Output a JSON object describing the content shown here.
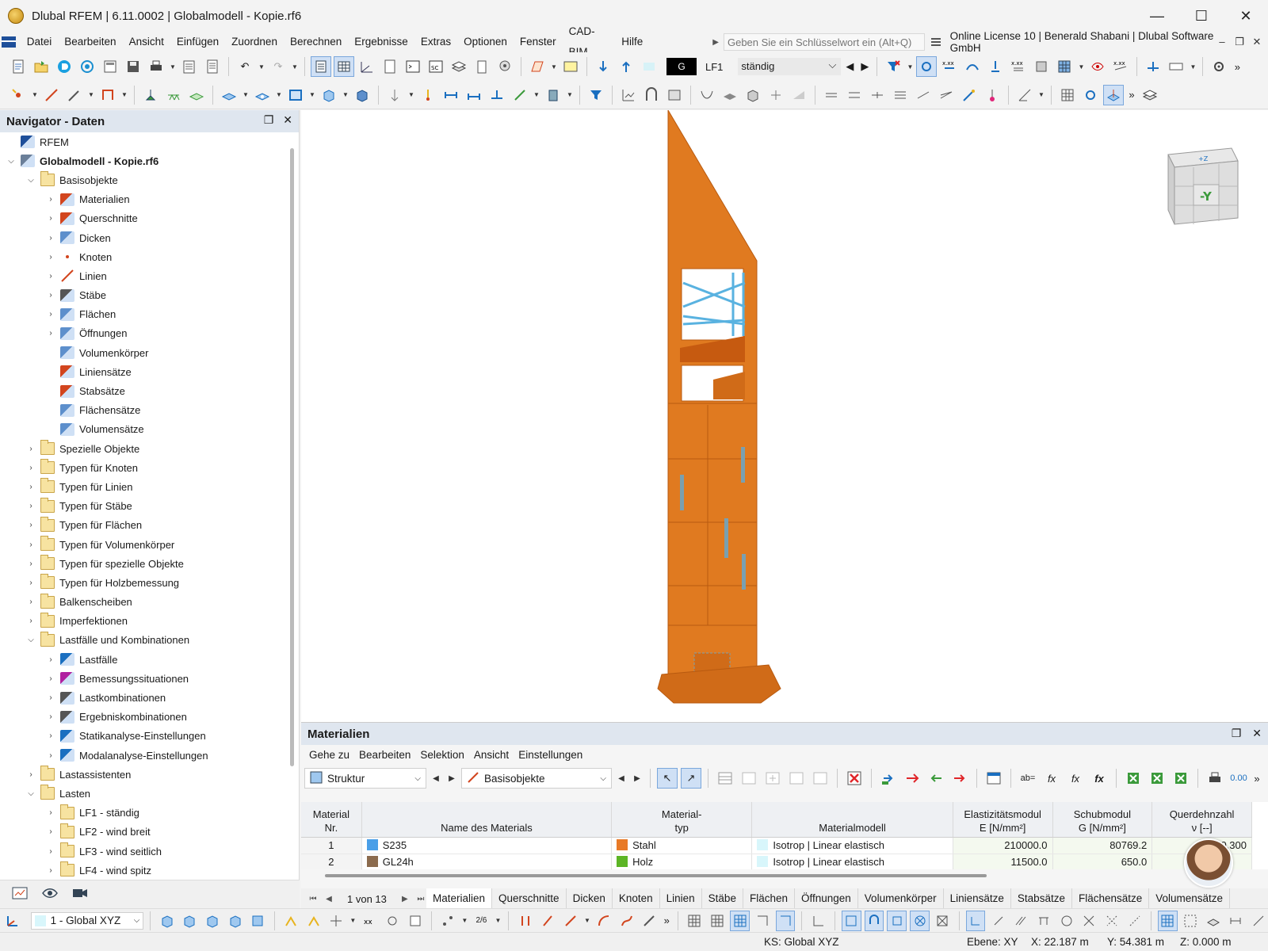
{
  "window": {
    "title": "Dlubal RFEM | 6.11.0002 | Globalmodell - Kopie.rf6",
    "minimize": "—",
    "maximize": "☐",
    "close": "✕"
  },
  "menubar": {
    "items": [
      "Datei",
      "Bearbeiten",
      "Ansicht",
      "Einfügen",
      "Zuordnen",
      "Berechnen",
      "Ergebnisse",
      "Extras",
      "Optionen",
      "Fenster",
      "CAD-BIM",
      "Hilfe"
    ],
    "search_placeholder": "Geben Sie ein Schlüsselwort ein (Alt+Q)",
    "license": "Online License 10 | Benerald Shabani | Dlubal Software GmbH"
  },
  "toolbar": {
    "loadcase_color_label": "G",
    "loadcase": "LF1",
    "loadcase_name": "ständig"
  },
  "navigator": {
    "title": "Navigator - Daten",
    "rows": [
      {
        "level": 0,
        "arrow": "",
        "icon": "rfem-icon",
        "label": "RFEM",
        "bold": false
      },
      {
        "level": 0,
        "arrow": "⌵",
        "icon": "model-icon",
        "label": "Globalmodell - Kopie.rf6",
        "bold": true
      },
      {
        "level": 1,
        "arrow": "⌵",
        "icon": "folder-icon",
        "label": "Basisobjekte",
        "bold": false
      },
      {
        "level": 2,
        "arrow": "›",
        "icon": "materials-icon",
        "label": "Materialien",
        "bold": false
      },
      {
        "level": 2,
        "arrow": "›",
        "icon": "cross-section-icon",
        "label": "Querschnitte",
        "bold": false
      },
      {
        "level": 2,
        "arrow": "›",
        "icon": "thickness-icon",
        "label": "Dicken",
        "bold": false
      },
      {
        "level": 2,
        "arrow": "›",
        "icon": "node-icon",
        "label": "Knoten",
        "bold": false
      },
      {
        "level": 2,
        "arrow": "›",
        "icon": "line-icon",
        "label": "Linien",
        "bold": false
      },
      {
        "level": 2,
        "arrow": "›",
        "icon": "member-icon",
        "label": "Stäbe",
        "bold": false
      },
      {
        "level": 2,
        "arrow": "›",
        "icon": "surface-icon",
        "label": "Flächen",
        "bold": false
      },
      {
        "level": 2,
        "arrow": "›",
        "icon": "opening-icon",
        "label": "Öffnungen",
        "bold": false
      },
      {
        "level": 2,
        "arrow": "",
        "icon": "solid-icon",
        "label": "Volumenkörper",
        "bold": false
      },
      {
        "level": 2,
        "arrow": "",
        "icon": "line-set-icon",
        "label": "Liniensätze",
        "bold": false
      },
      {
        "level": 2,
        "arrow": "",
        "icon": "member-set-icon",
        "label": "Stabsätze",
        "bold": false
      },
      {
        "level": 2,
        "arrow": "",
        "icon": "surface-set-icon",
        "label": "Flächensätze",
        "bold": false
      },
      {
        "level": 2,
        "arrow": "",
        "icon": "solid-set-icon",
        "label": "Volumensätze",
        "bold": false
      },
      {
        "level": 1,
        "arrow": "›",
        "icon": "folder-icon",
        "label": "Spezielle Objekte",
        "bold": false
      },
      {
        "level": 1,
        "arrow": "›",
        "icon": "folder-icon",
        "label": "Typen für Knoten",
        "bold": false
      },
      {
        "level": 1,
        "arrow": "›",
        "icon": "folder-icon",
        "label": "Typen für Linien",
        "bold": false
      },
      {
        "level": 1,
        "arrow": "›",
        "icon": "folder-icon",
        "label": "Typen für Stäbe",
        "bold": false
      },
      {
        "level": 1,
        "arrow": "›",
        "icon": "folder-icon",
        "label": "Typen für Flächen",
        "bold": false
      },
      {
        "level": 1,
        "arrow": "›",
        "icon": "folder-icon",
        "label": "Typen für Volumenkörper",
        "bold": false
      },
      {
        "level": 1,
        "arrow": "›",
        "icon": "folder-icon",
        "label": "Typen für spezielle Objekte",
        "bold": false
      },
      {
        "level": 1,
        "arrow": "›",
        "icon": "folder-icon",
        "label": "Typen für Holzbemessung",
        "bold": false
      },
      {
        "level": 1,
        "arrow": "›",
        "icon": "folder-icon",
        "label": "Balkenscheiben",
        "bold": false
      },
      {
        "level": 1,
        "arrow": "›",
        "icon": "folder-icon",
        "label": "Imperfektionen",
        "bold": false
      },
      {
        "level": 1,
        "arrow": "⌵",
        "icon": "folder-icon",
        "label": "Lastfälle und Kombinationen",
        "bold": false
      },
      {
        "level": 2,
        "arrow": "›",
        "icon": "load-case-icon",
        "label": "Lastfälle",
        "bold": false
      },
      {
        "level": 2,
        "arrow": "›",
        "icon": "design-situation-icon",
        "label": "Bemessungssituationen",
        "bold": false
      },
      {
        "level": 2,
        "arrow": "›",
        "icon": "load-combination-icon",
        "label": "Lastkombinationen",
        "bold": false
      },
      {
        "level": 2,
        "arrow": "›",
        "icon": "result-combination-icon",
        "label": "Ergebniskombinationen",
        "bold": false
      },
      {
        "level": 2,
        "arrow": "›",
        "icon": "static-settings-icon",
        "label": "Statikanalyse-Einstellungen",
        "bold": false
      },
      {
        "level": 2,
        "arrow": "›",
        "icon": "modal-settings-icon",
        "label": "Modalanalyse-Einstellungen",
        "bold": false
      },
      {
        "level": 1,
        "arrow": "›",
        "icon": "folder-icon",
        "label": "Lastassistenten",
        "bold": false
      },
      {
        "level": 1,
        "arrow": "⌵",
        "icon": "folder-icon",
        "label": "Lasten",
        "bold": false
      },
      {
        "level": 2,
        "arrow": "›",
        "icon": "folder-icon",
        "label": "LF1 - ständig",
        "bold": false
      },
      {
        "level": 2,
        "arrow": "›",
        "icon": "folder-icon",
        "label": "LF2 - wind breit",
        "bold": false
      },
      {
        "level": 2,
        "arrow": "›",
        "icon": "folder-icon",
        "label": "LF3 - wind seitlich",
        "bold": false
      },
      {
        "level": 2,
        "arrow": "›",
        "icon": "folder-icon",
        "label": "LF4 - wind spitz",
        "bold": false
      }
    ]
  },
  "viewport": {
    "view_cube_label": "-Y",
    "view_cube_top": "+Z"
  },
  "materials_panel": {
    "title": "Materialien",
    "menu": [
      "Gehe zu",
      "Bearbeiten",
      "Selektion",
      "Ansicht",
      "Einstellungen"
    ],
    "structure_dropdown": "Struktur",
    "objects_dropdown": "Basisobjekte",
    "columns": {
      "nr": [
        "Material",
        "Nr."
      ],
      "name": "Name des Materials",
      "type": [
        "Material-",
        "typ"
      ],
      "model": "Materialmodell",
      "e": [
        "Elastizitätsmodul",
        "E [N/mm²]"
      ],
      "g": [
        "Schubmodul",
        "G [N/mm²]"
      ],
      "nu": [
        "Querdehnzahl",
        "ν [--]"
      ]
    },
    "rows": [
      {
        "nr": "1",
        "name": "S235",
        "name_color": "#4a9fe8",
        "type": "Stahl",
        "type_color": "#e87a27",
        "model": "Isotrop | Linear elastisch",
        "e": "210000.0",
        "g": "80769.2",
        "nu": "0.300"
      },
      {
        "nr": "2",
        "name": "GL24h",
        "name_color": "#8b6b4e",
        "type": "Holz",
        "type_color": "#5db526",
        "model": "Isotrop | Linear elastisch",
        "e": "11500.0",
        "g": "650.0",
        "nu": ""
      }
    ],
    "pager": "1 von 13",
    "tabs": [
      "Materialien",
      "Querschnitte",
      "Dicken",
      "Knoten",
      "Linien",
      "Stäbe",
      "Flächen",
      "Öffnungen",
      "Volumenkörper",
      "Liniensätze",
      "Stabsätze",
      "Flächensätze",
      "Volumensätze"
    ],
    "active_tab": "Materialien"
  },
  "bottom_toolbar": {
    "coordinate_system": "1 - Global XYZ"
  },
  "status": {
    "ks": "KS: Global XYZ",
    "plane": "Ebene: XY",
    "x": "X: 22.187 m",
    "y": "Y: 54.381 m",
    "z": "Z: 0.000 m"
  }
}
